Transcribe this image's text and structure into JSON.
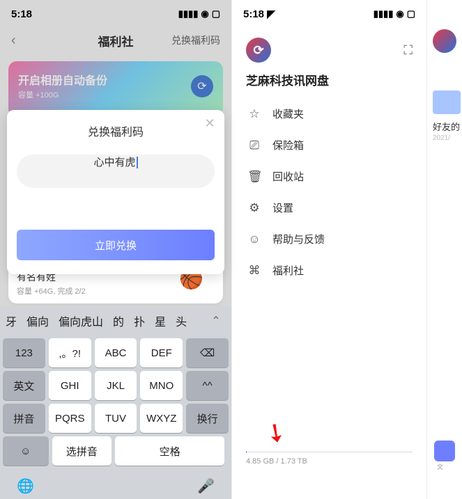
{
  "left": {
    "status_time": "5:18",
    "header_title": "福利社",
    "header_action": "兑换福利码",
    "banner_title": "开启相册自动备份",
    "banner_sub": "容量 +100G",
    "modal_title": "兑换福利码",
    "modal_input_value": "心中有虎",
    "modal_button": "立即兑换",
    "peek_title": "有名有姓",
    "peek_sub": "容量 +64G, 完成 2/2",
    "candidates": [
      "牙",
      "偏向",
      "偏向虎山",
      "的",
      "扑",
      "星",
      "头"
    ],
    "keys": {
      "r1": [
        "123",
        ",。?!",
        "ABC",
        "DEF"
      ],
      "r2": [
        "英文",
        "GHI",
        "JKL",
        "MNO"
      ],
      "r3": [
        "拼音",
        "PQRS",
        "TUV",
        "WXYZ"
      ],
      "emoji": "☺",
      "select": "选拼音",
      "space": "空格",
      "caret": "^^",
      "enter": "换行"
    }
  },
  "mid": {
    "status_time": "5:18",
    "app_title": "芝麻科技讯网盘",
    "menu": [
      {
        "icon": "☆",
        "label": "收藏夹"
      },
      {
        "icon": "⎚",
        "label": "保险箱"
      },
      {
        "icon": "🗑",
        "label": "回收站"
      },
      {
        "icon": "⚙",
        "label": "设置"
      },
      {
        "icon": "☺",
        "label": "帮助与反馈"
      },
      {
        "icon": "⌘",
        "label": "福利社"
      }
    ],
    "storage_text": "4.85 GB / 1.73 TB"
  },
  "right": {
    "folder_label": "好友的",
    "folder_date": "2021/",
    "bottom_label": "文"
  }
}
